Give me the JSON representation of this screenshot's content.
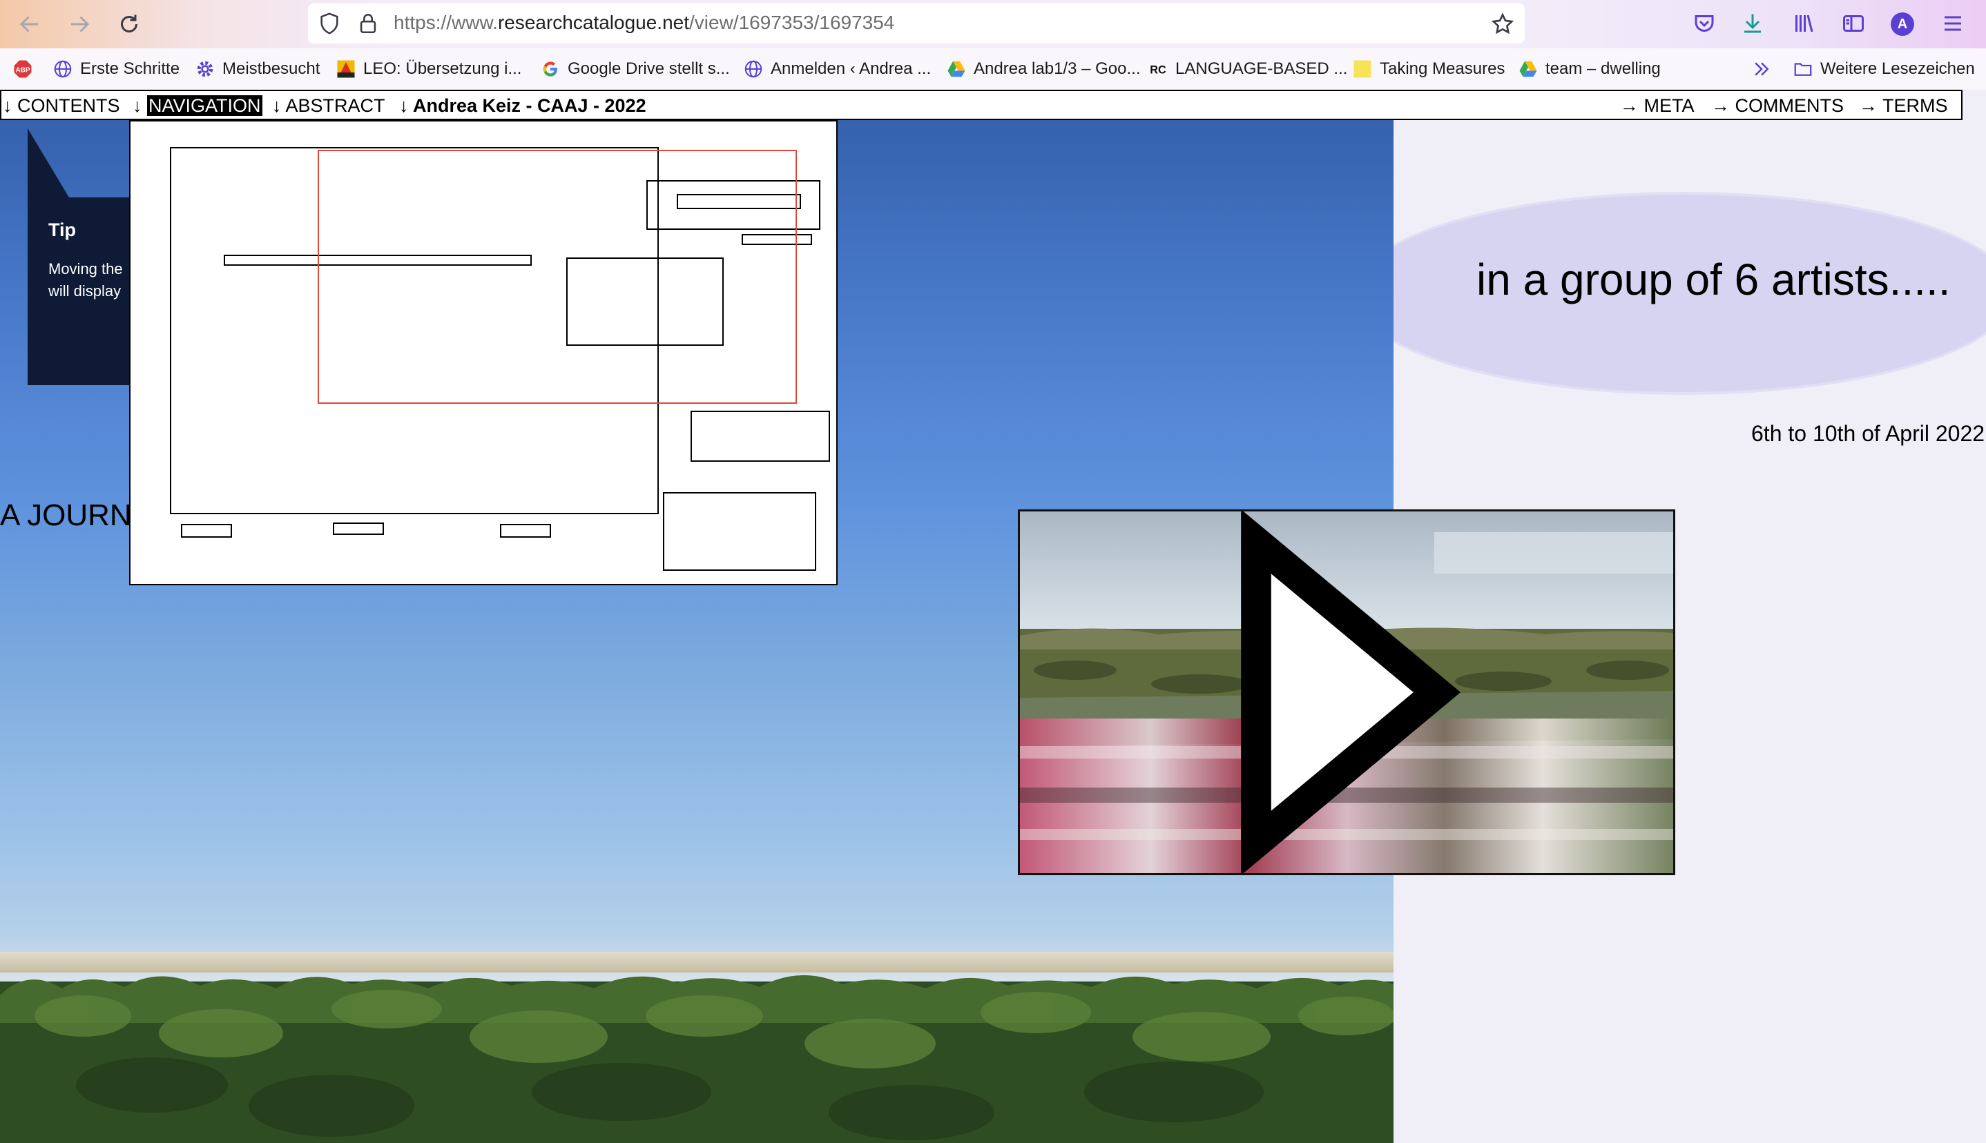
{
  "browser": {
    "url_prefix": "https://www.",
    "url_domain": "researchcatalogue.net",
    "url_path": "/view/1697353/1697354",
    "avatar_letter": "A",
    "bookmarks": [
      {
        "label": "Erste Schritte",
        "icon": "globe-icon"
      },
      {
        "label": "Meistbesucht",
        "icon": "gear-icon"
      },
      {
        "label": "LEO: Übersetzung i...",
        "icon": "leo-icon"
      },
      {
        "label": "Google Drive stellt s...",
        "icon": "google-icon"
      },
      {
        "label": "Anmelden ‹ Andrea ...",
        "icon": "globe-icon"
      },
      {
        "label": "Andrea lab1/3 – Goo...",
        "icon": "drive-icon"
      },
      {
        "label": "LANGUAGE-BASED ...",
        "icon": "rc-icon"
      },
      {
        "label": "Taking Measures",
        "icon": "note-icon"
      },
      {
        "label": "team – dwelling",
        "icon": "drive-icon"
      }
    ],
    "more_bookmarks": "Weitere Lesezeichen"
  },
  "rc_nav": {
    "contents": "CONTENTS",
    "navigation": "NAVIGATION",
    "abstract": "ABSTRACT",
    "title": "Andrea Keiz - CAAJ - 2022",
    "meta": "META",
    "comments": "COMMENTS",
    "terms": "TERMS",
    "down_arrow": "↓",
    "right_arrow": "→"
  },
  "tip": {
    "title": "Tip",
    "line1": "Moving the",
    "line2": "will display"
  },
  "page": {
    "journey_text": "A JOURN",
    "group_text": "in a group of 6 artists.....",
    "date_text": "6th to 10th of April 2022"
  },
  "colors": {
    "accent_purple": "#5b3fd4",
    "tip_bg": "#0f1b36",
    "minimap_viewport": "#e0483a",
    "ellipse": "#d6d4f0"
  }
}
